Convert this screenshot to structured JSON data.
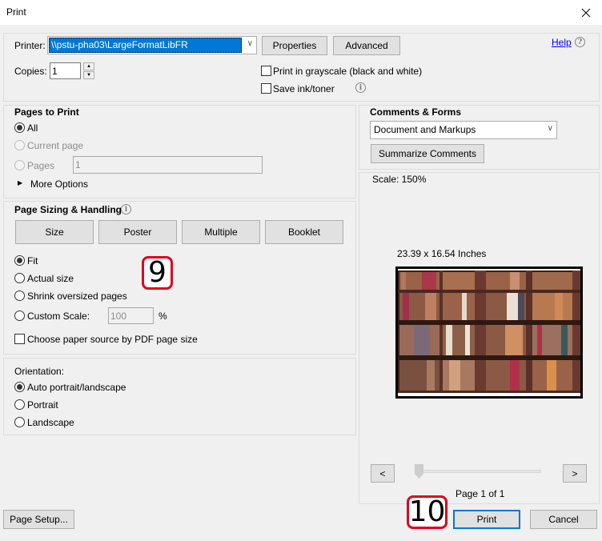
{
  "window": {
    "title": "Print",
    "close_label": "×"
  },
  "printer": {
    "label": "Printer:",
    "selected": "\\\\pstu-pha03\\LargeFormatLibFR",
    "properties_label": "Properties",
    "advanced_label": "Advanced",
    "help_label": "Help",
    "help_icon": "?",
    "copies_label": "Copies:",
    "copies_value": "1",
    "grayscale_label": "Print in grayscale (black and white)",
    "grayscale_checked": false,
    "save_ink_label": "Save ink/toner",
    "save_ink_checked": false,
    "info_icon": "i"
  },
  "pages_to_print": {
    "title": "Pages to Print",
    "options": [
      {
        "label": "All",
        "selected": true,
        "enabled": true
      },
      {
        "label": "Current page",
        "selected": false,
        "enabled": false
      },
      {
        "label": "Pages",
        "selected": false,
        "enabled": false
      }
    ],
    "pages_value": "1",
    "more_options_label": "More Options"
  },
  "page_sizing": {
    "title": "Page Sizing & Handling",
    "info_icon": "i",
    "tabs": [
      "Size",
      "Poster",
      "Multiple",
      "Booklet"
    ],
    "options": [
      {
        "label": "Fit",
        "selected": true
      },
      {
        "label": "Actual size",
        "selected": false
      },
      {
        "label": "Shrink oversized pages",
        "selected": false
      },
      {
        "label": "Custom Scale:",
        "selected": false
      }
    ],
    "custom_scale_value": "100",
    "percent_label": "%",
    "paper_source_label": "Choose paper source by PDF page size",
    "paper_source_checked": false
  },
  "orientation": {
    "title": "Orientation:",
    "options": [
      {
        "label": "Auto portrait/landscape",
        "selected": true
      },
      {
        "label": "Portrait",
        "selected": false
      },
      {
        "label": "Landscape",
        "selected": false
      }
    ]
  },
  "comments_forms": {
    "title": "Comments & Forms",
    "selected": "Document and Markups",
    "summarize_label": "Summarize Comments"
  },
  "preview": {
    "scale_label": "Scale: 150%",
    "dimensions_label": "23.39 x 16.54 Inches",
    "image_description": "bookshelf-photo",
    "prev_label": "<",
    "next_label": ">",
    "page_label": "Page 1 of 1",
    "slider_position": 0
  },
  "footer": {
    "page_setup_label": "Page Setup...",
    "print_label": "Print",
    "cancel_label": "Cancel"
  },
  "annotations": {
    "callout_9": "9",
    "callout_10": "10",
    "callout_color": "#e0001b"
  }
}
